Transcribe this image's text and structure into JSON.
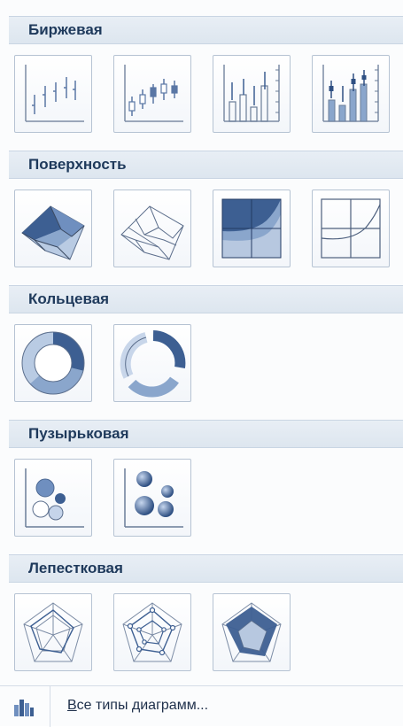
{
  "sections": [
    {
      "title": "Биржевая",
      "items": [
        "stock-hlc-icon",
        "stock-ohlc-icon",
        "stock-volume-hlc-icon",
        "stock-volume-ohlc-icon"
      ]
    },
    {
      "title": "Поверхность",
      "items": [
        "surface-3d-icon",
        "surface-wireframe-3d-icon",
        "contour-icon",
        "contour-wireframe-icon"
      ]
    },
    {
      "title": "Кольцевая",
      "items": [
        "doughnut-icon",
        "exploded-doughnut-icon"
      ]
    },
    {
      "title": "Пузырьковая",
      "items": [
        "bubble-icon",
        "bubble-3d-icon"
      ]
    },
    {
      "title": "Лепестковая",
      "items": [
        "radar-icon",
        "radar-markers-icon",
        "filled-radar-icon"
      ]
    }
  ],
  "footer": {
    "underlined_char": "В",
    "label_rest": "се типы диаграмм...",
    "icon": "chart-types-icon"
  },
  "colors": {
    "header_bg": "#dde6ef",
    "header_text": "#1e395b",
    "icon_fill": "#8aa6cc",
    "icon_dark": "#3d5f92",
    "icon_stroke": "#6a7d98"
  }
}
